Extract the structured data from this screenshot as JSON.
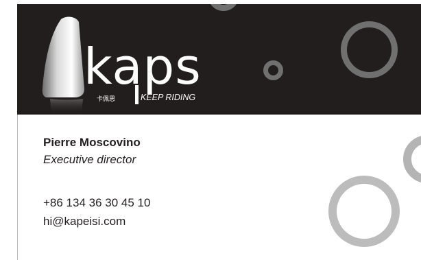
{
  "brand": {
    "wordmark": "kaps",
    "chinese_name": "卡佩思",
    "tagline": "KEEP RIDING",
    "logo_icon": "saddle-logo-icon"
  },
  "person": {
    "name": "Pierre Moscovino",
    "title": "Executive director"
  },
  "contact": {
    "phone": "+86 134 36 30 45 10",
    "email": "hi@kapeisi.com"
  },
  "colors": {
    "banner": "#221e1d",
    "ring_dark": "#707070",
    "ring_light": "#b4b4b4",
    "text": "#231f20"
  }
}
